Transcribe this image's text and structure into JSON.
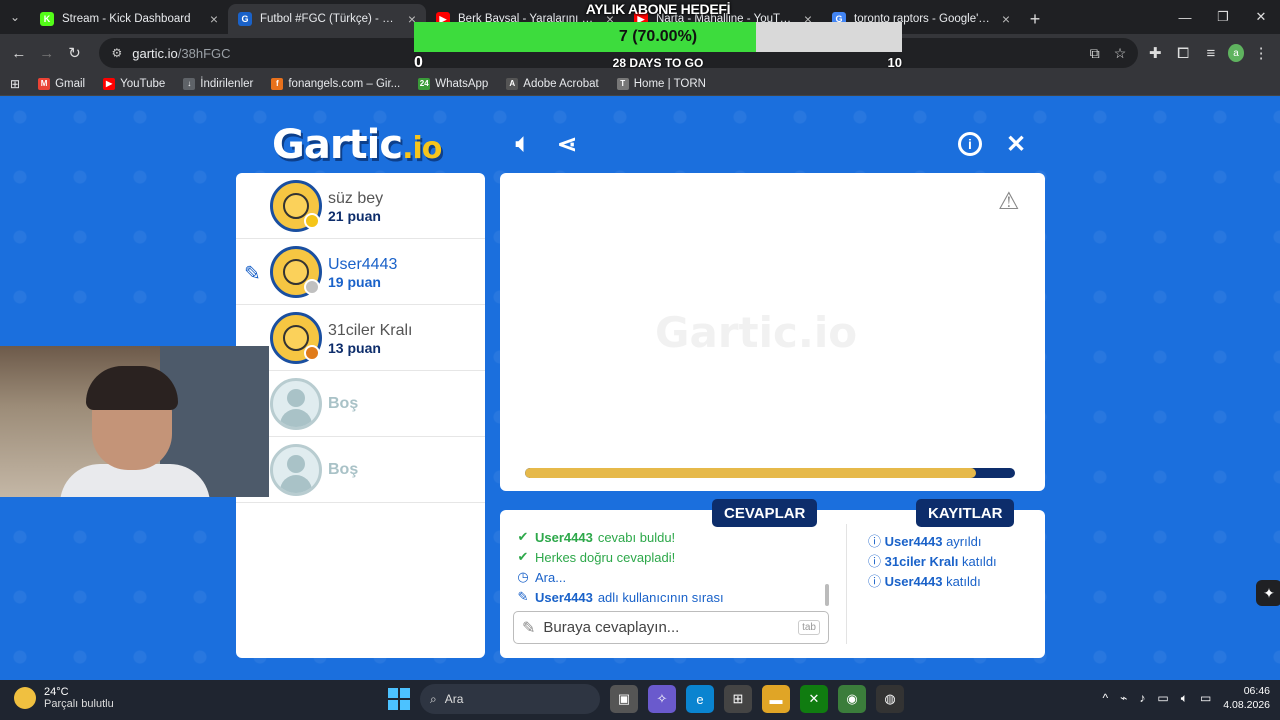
{
  "browser": {
    "tabs": [
      {
        "title": "Stream - Kick Dashboard",
        "favicon": "K",
        "color": "#53fc18",
        "active": false
      },
      {
        "title": "Futbol #FGC (Türkçe) - Gartic.io",
        "favicon": "G",
        "color": "#1a62c9",
        "active": true
      },
      {
        "title": "Berk Baysal - Yaralarını Ben Sar",
        "favicon": "▶",
        "color": "#ff0000",
        "active": false
      },
      {
        "title": "Narta - Mahalline - YouTube",
        "favicon": "▶",
        "color": "#ff0000",
        "active": false
      },
      {
        "title": "toronto raptors - Google'da Ara",
        "favicon": "G",
        "color": "#4285f4",
        "active": false
      }
    ],
    "url_host": "gartic.io",
    "url_path": "/38hFGC",
    "profile_initial": "a",
    "bookmarks": [
      {
        "label": "Gmail",
        "icon": "gmail-icon",
        "color": "#ea4335",
        "glyph": "M"
      },
      {
        "label": "YouTube",
        "icon": "youtube-icon",
        "color": "#ff0000",
        "glyph": "▶"
      },
      {
        "label": "İndirilenler",
        "icon": "download-icon",
        "color": "#5f6368",
        "glyph": "↓"
      },
      {
        "label": "fonangels.com – Gir...",
        "icon": "fonangels-icon",
        "color": "#e8711c",
        "glyph": "f"
      },
      {
        "label": "WhatsApp",
        "icon": "whatsapp-icon",
        "color": "#3a9b39",
        "glyph": "24"
      },
      {
        "label": "Adobe Acrobat",
        "icon": "acrobat-icon",
        "color": "#555",
        "glyph": "A"
      },
      {
        "label": "Home | TORN",
        "icon": "torn-icon",
        "color": "#777",
        "glyph": "T"
      }
    ]
  },
  "goal": {
    "title": "AYLIK ABONE HEDEFİ",
    "value_text": "7 (70.00%)",
    "progress": 0.7,
    "min": "0",
    "max": "10",
    "days_text": "28 DAYS TO GO"
  },
  "game": {
    "logo_text": "Gartic",
    "logo_suffix": ".io",
    "watermark": "Gartic.io",
    "players": [
      {
        "name": "süz bey",
        "score": "21 puan",
        "badge": "#f5c518",
        "drawing": false,
        "empty": false
      },
      {
        "name": "User4443",
        "score": "19 puan",
        "badge": "#c0c0c0",
        "drawing": true,
        "empty": false
      },
      {
        "name": "31ciler Kralı",
        "score": "13 puan",
        "badge": "#e07b1a",
        "drawing": false,
        "empty": false
      },
      {
        "name": "Boş",
        "score": "",
        "badge": "",
        "drawing": false,
        "empty": true
      },
      {
        "name": "Boş",
        "score": "",
        "badge": "",
        "drawing": false,
        "empty": true
      }
    ],
    "timer_progress": 0.92,
    "answers_label": "CEVAPLAR",
    "logs_label": "KAYITLAR",
    "answers": [
      {
        "icon": "check-icon",
        "glyph": "✔",
        "user": "User4443",
        "text": " cevabı buldu!",
        "style": "green"
      },
      {
        "icon": "check-icon",
        "glyph": "✔",
        "user": "",
        "text": "Herkes doğru cevapladi!",
        "style": "green"
      },
      {
        "icon": "clock-icon",
        "glyph": "◷",
        "user": "",
        "text": "Ara...",
        "style": "blue"
      },
      {
        "icon": "pencil-icon",
        "glyph": "✎",
        "user": "User4443",
        "text": " adlı kullanıcının sırası",
        "style": "blue"
      }
    ],
    "logs": [
      {
        "user": "User4443",
        "text": " ayrıldı"
      },
      {
        "user": "31ciler Kralı",
        "text": " katıldı"
      },
      {
        "user": "User4443",
        "text": " katıldı"
      }
    ],
    "answer_placeholder": "Buraya cevaplayın...",
    "tab_hint": "tab"
  },
  "taskbar": {
    "temp": "24°C",
    "weather": "Parçalı bulutlu",
    "search": "Ara",
    "time": "06:46",
    "date": "4.08.2026"
  }
}
